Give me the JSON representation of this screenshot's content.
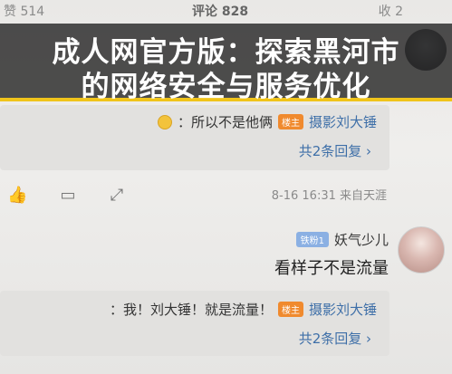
{
  "banner": {
    "line1": "成人网官方版：探索黑河市",
    "line2": "的网络安全与服务优化"
  },
  "top_row": {
    "left": "赞 514",
    "mid": "评论 828",
    "right": "收 2"
  },
  "reply1": {
    "author": "摄影刘大锤",
    "badge": "楼主",
    "text": "：所以不是他俩",
    "more": "共2条回复 ›"
  },
  "meta": {
    "text": "8-16 16:31 来自天涯"
  },
  "comment2": {
    "user": "妖气少儿",
    "level": "铁粉1",
    "text": "看样子不是流量"
  },
  "reply2": {
    "author": "摄影刘大锤",
    "badge": "楼主",
    "text": "：我！刘大锤！就是流量！",
    "more": "共2条回复 ›"
  },
  "icons": [
    "like-icon",
    "comment-icon",
    "share-icon"
  ]
}
